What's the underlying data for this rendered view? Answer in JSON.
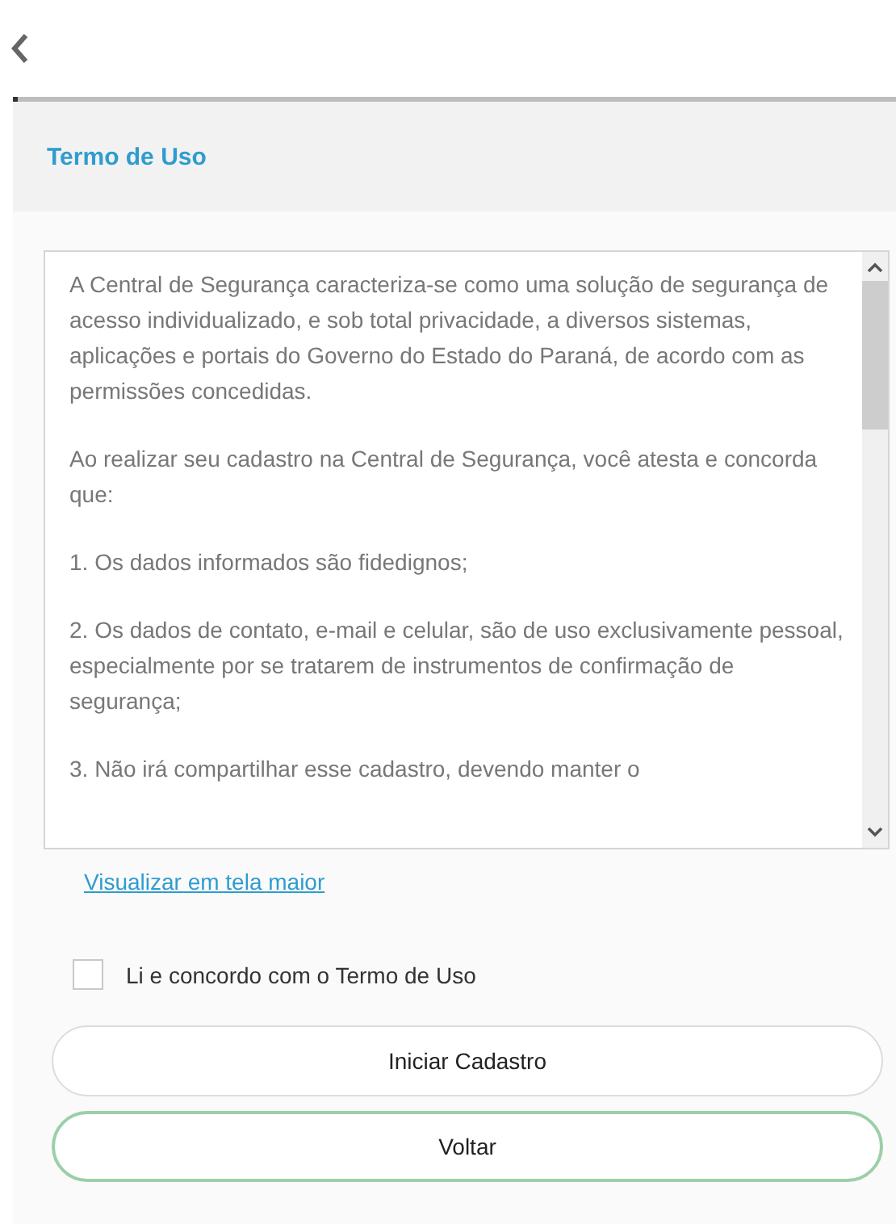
{
  "header": {
    "title": "Termo de Uso"
  },
  "terms": {
    "paragraphs": [
      "A Central de Segurança caracteriza-se como uma solução de segurança de acesso individualizado, e sob total privacidade, a diversos sistemas, aplicações e portais do Governo do Estado do Paraná, de acordo com as permissões concedidas.",
      "Ao realizar seu cadastro na Central de Segurança, você atesta e concorda que:",
      "1. Os dados informados são fidedignos;",
      "2. Os dados de contato, e-mail e celular, são de uso exclusivamente pessoal, especialmente por se tratarem de instrumentos de confirmação de segurança;",
      "3. Não irá compartilhar esse cadastro, devendo manter o"
    ]
  },
  "link": "Visualizar em tela maior",
  "agree": {
    "label": "Li e concordo com o Termo de Uso",
    "checked": false
  },
  "buttons": [
    {
      "label": "Iniciar Cadastro",
      "kind": "primary"
    },
    {
      "label": "Voltar",
      "kind": "focused"
    }
  ]
}
